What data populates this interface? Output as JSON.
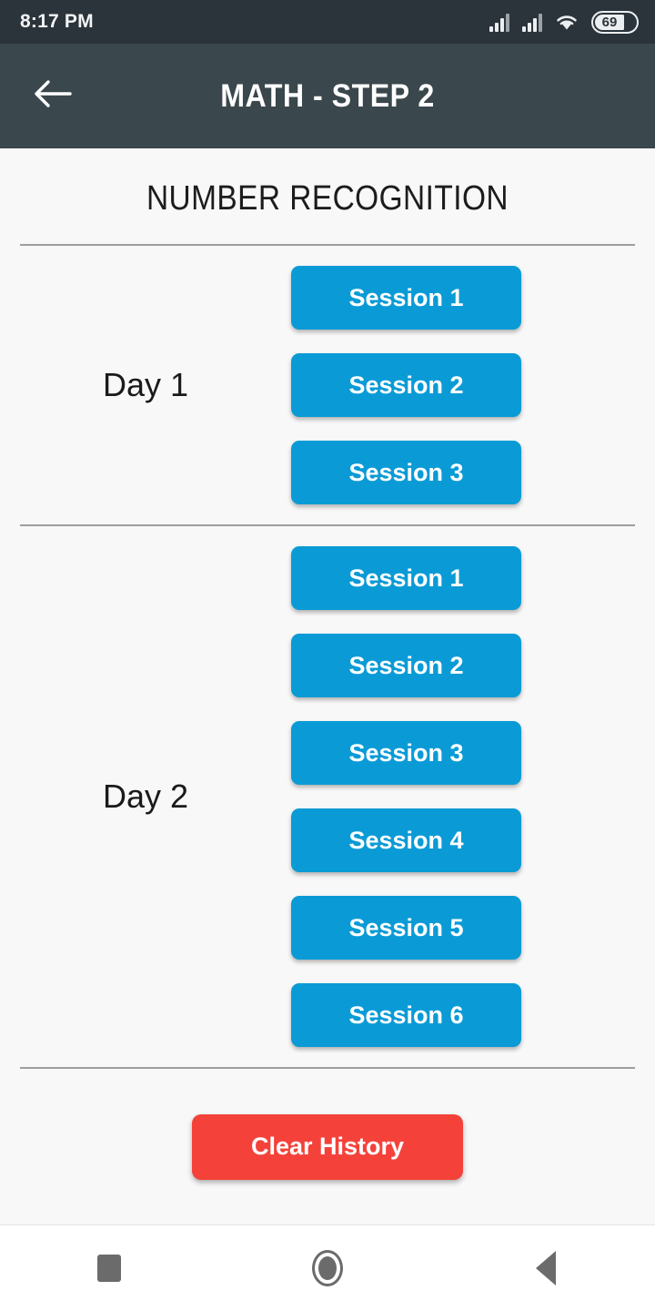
{
  "status_bar": {
    "time": "8:17 PM",
    "battery_level": "69",
    "icons": [
      "signal-icon",
      "signal-icon",
      "wifi-icon",
      "battery-icon"
    ]
  },
  "app_bar": {
    "back_icon": "back-arrow-icon",
    "title": "MATH - STEP 2"
  },
  "page": {
    "heading": "NUMBER RECOGNITION"
  },
  "days": [
    {
      "label": "Day 1",
      "sessions": [
        {
          "label": "Session 1"
        },
        {
          "label": "Session 2"
        },
        {
          "label": "Session 3"
        }
      ]
    },
    {
      "label": "Day 2",
      "sessions": [
        {
          "label": "Session 1"
        },
        {
          "label": "Session 2"
        },
        {
          "label": "Session 3"
        },
        {
          "label": "Session 4"
        },
        {
          "label": "Session 5"
        },
        {
          "label": "Session 6"
        }
      ]
    }
  ],
  "footer": {
    "clear_history_label": "Clear History"
  },
  "nav_bar": {
    "recents_icon": "square-recents-icon",
    "home_icon": "circle-home-icon",
    "back_icon": "triangle-back-icon"
  },
  "colors": {
    "status_bar": "#2b333b",
    "app_bar": "#3a474c",
    "background": "#f8f8f8",
    "session_button": "#0a9bd6",
    "clear_button": "#f4423a",
    "divider": "#9e9e9e"
  }
}
